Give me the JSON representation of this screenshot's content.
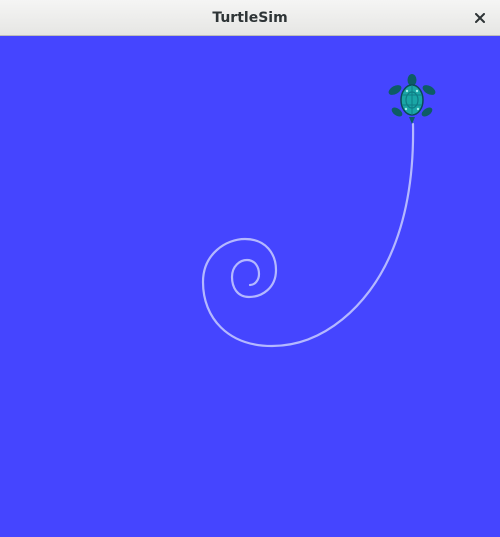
{
  "window": {
    "title": "TurtleSim",
    "close_icon": "close-icon"
  },
  "canvas": {
    "background": "#4545ff",
    "pen_color": "#b4b8ff",
    "turtle_icon": "turtle-icon",
    "turtle_shell_color": "#1aa6a6",
    "turtle_body_color": "#0d5c66"
  }
}
